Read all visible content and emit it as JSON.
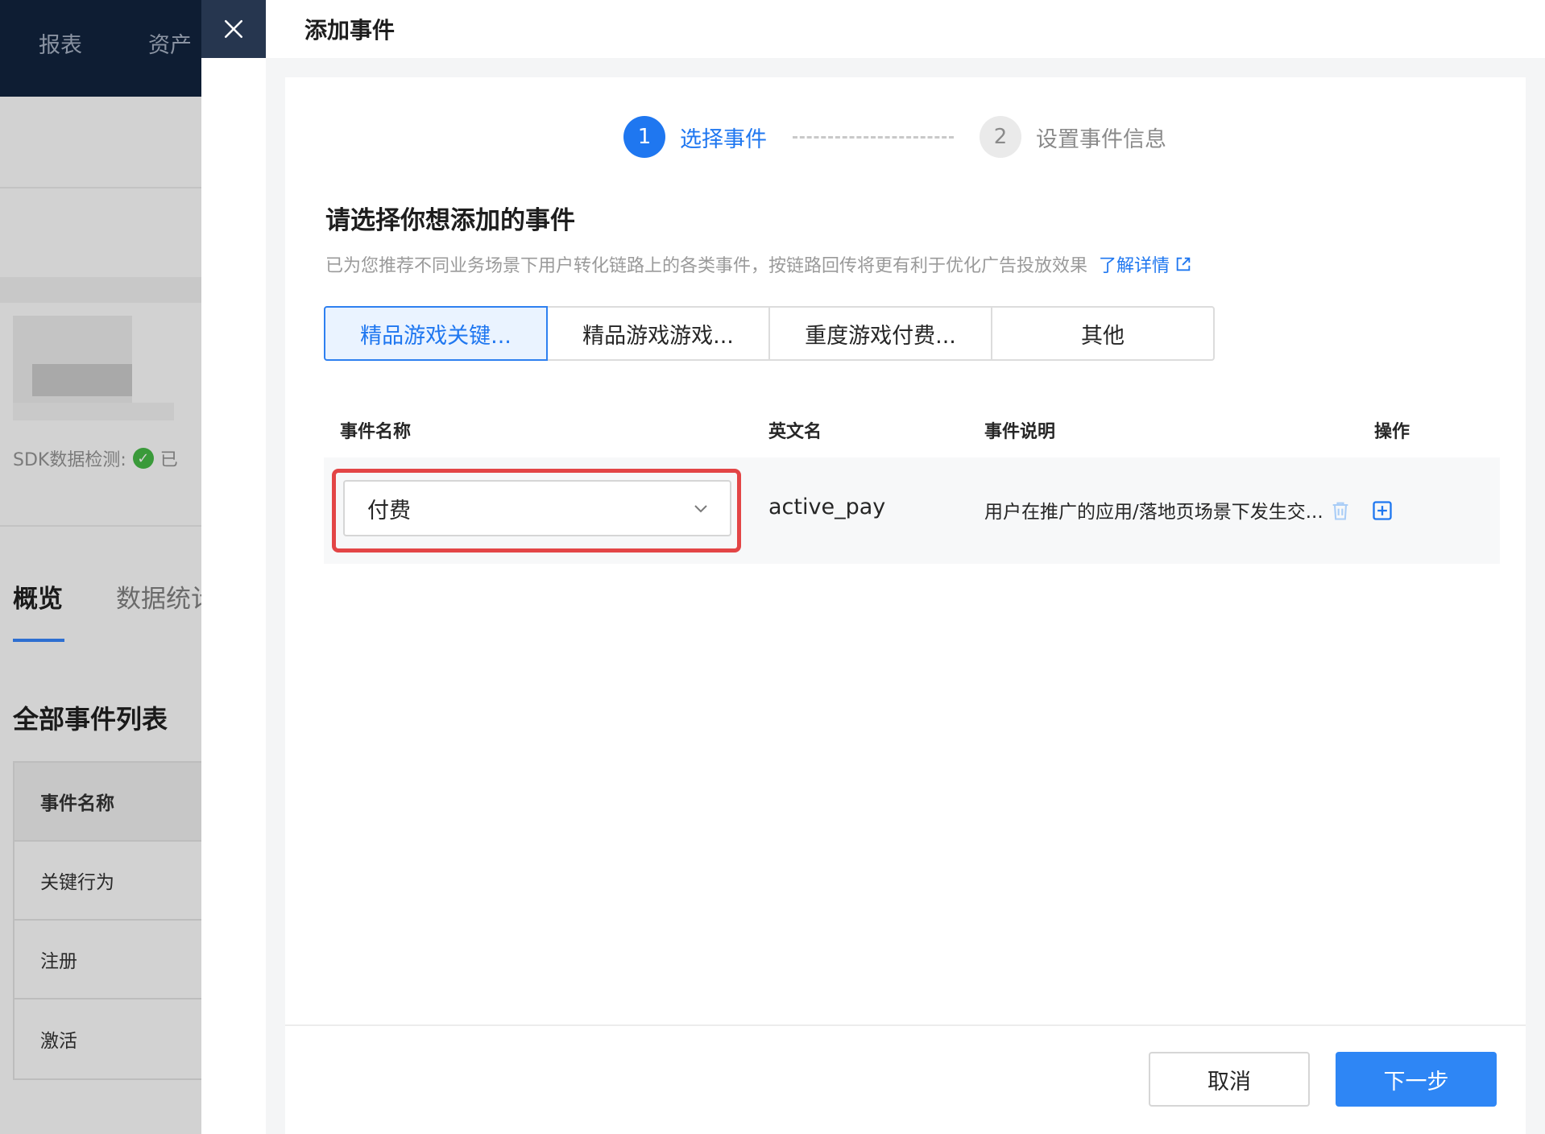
{
  "background": {
    "nav": [
      "报表",
      "资产"
    ],
    "sdk_label": "SDK数据检测:",
    "sdk_status": "已",
    "tabs": [
      "概览",
      "数据统计"
    ],
    "section_title": "全部事件列表",
    "table_header": "事件名称",
    "rows": [
      "关键行为",
      "注册",
      "激活"
    ]
  },
  "drawer": {
    "title": "添加事件",
    "steps": [
      {
        "number": "1",
        "label": "选择事件",
        "state": "active"
      },
      {
        "number": "2",
        "label": "设置事件信息",
        "state": "inactive"
      }
    ],
    "section_title": "请选择你想添加的事件",
    "description": "已为您推荐不同业务场景下用户转化链路上的各类事件，按链路回传将更有利于优化广告投放效果",
    "learn_more": "了解详情",
    "category_tabs": [
      {
        "label": "精品游戏关键...",
        "selected": true
      },
      {
        "label": "精品游戏游戏...",
        "selected": false
      },
      {
        "label": "重度游戏付费...",
        "selected": false
      },
      {
        "label": "其他",
        "selected": false
      }
    ],
    "table": {
      "headers": {
        "name": "事件名称",
        "english": "英文名",
        "desc": "事件说明",
        "ops": "操作"
      },
      "rows": [
        {
          "name": "付费",
          "english": "active_pay",
          "desc": "用户在推广的应用/落地页场景下发生交..."
        }
      ]
    },
    "footer": {
      "cancel": "取消",
      "next": "下一步"
    }
  },
  "colors": {
    "accent": "#1f77f0",
    "highlight": "#e34546",
    "primary_button": "#2e86f5"
  }
}
